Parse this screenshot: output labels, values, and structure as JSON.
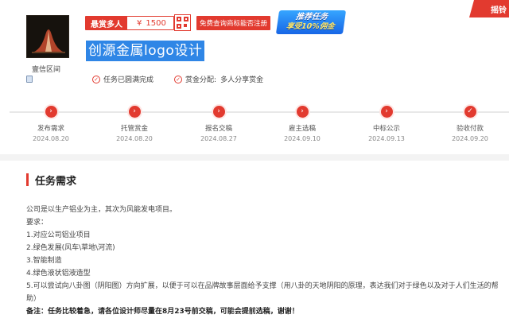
{
  "colors": {
    "accent": "#e23a2f",
    "title_highlight": "#2f86e6",
    "promo_blue": "#1866e6"
  },
  "seller": {
    "name": "壹信区间",
    "avatar_icon": "tent-logo-icon",
    "badge_icon": "phone-verified-icon"
  },
  "header": {
    "task_mode": "悬赏多人",
    "price_symbol": "¥",
    "price": "1500",
    "qr_icon": "qr-code-icon",
    "register_button": "免费查询商标能否注册",
    "promo_line1": "推荐任务",
    "promo_line2": "享受10%佣金",
    "corner_label": "摇铃"
  },
  "task": {
    "title": "创源金属logo设计",
    "status": "任务已圆满完成",
    "reward_label": "赏金分配:",
    "reward_value": "多人分享赏金"
  },
  "steps": [
    {
      "label": "发布需求",
      "date": "2024.08.20"
    },
    {
      "label": "托管赏金",
      "date": "2024.08.20"
    },
    {
      "label": "报名交稿",
      "date": "2024.08.27"
    },
    {
      "label": "雇主选稿",
      "date": "2024.09.10"
    },
    {
      "label": "中标公示",
      "date": "2024.09.13"
    },
    {
      "label": "验收付款",
      "date": "2024.09.20"
    }
  ],
  "requirements": {
    "section_title": "任务需求",
    "intro": "公司是以生产铝业为主，其次为风能发电项目。",
    "req_label": "要求：",
    "items": [
      "1.对应公司铝业项目",
      "2.绿色发展(风车\\草地\\河流)",
      "3.智能制造",
      "4.绿色液状铝液造型",
      "5.可以尝试向八卦图（阴阳图）方向扩展，以便于可以在品牌故事层面给予支撑（用八卦的天地阴阳的原理，表达我们对于绿色以及对于人们生活的帮助）"
    ],
    "note": "备注：任务比较着急，请各位设计师尽量在8月23号前交稿，可能会提前选稿，谢谢！"
  }
}
